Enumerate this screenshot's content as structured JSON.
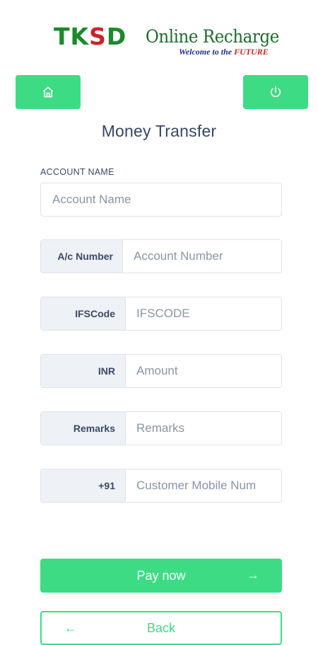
{
  "logo": {
    "brand_tk": "TK",
    "brand_s": "S",
    "brand_d": "D",
    "title": "Online Recharge",
    "tagline_prefix": "Welcome to the ",
    "tagline_future": "FUTURE"
  },
  "header": {
    "home_icon": "home-icon",
    "power_icon": "power-icon",
    "accent_color": "#3ddc84"
  },
  "page": {
    "title": "Money Transfer"
  },
  "form": {
    "account_name": {
      "label": "ACCOUNT NAME",
      "placeholder": "Account Name"
    },
    "account_number": {
      "addon": "A/c Number",
      "placeholder": "Account Number"
    },
    "ifsc": {
      "addon": "IFSCode",
      "placeholder": "IFSCODE"
    },
    "amount": {
      "addon": "INR",
      "placeholder": "Amount"
    },
    "remarks": {
      "addon": "Remarks",
      "placeholder": "Remarks"
    },
    "mobile": {
      "addon": "+91",
      "placeholder": "Customer Mobile Num"
    }
  },
  "actions": {
    "pay_label": "Pay now",
    "pay_arrow": "→",
    "back_label": "Back",
    "back_arrow": "←"
  }
}
